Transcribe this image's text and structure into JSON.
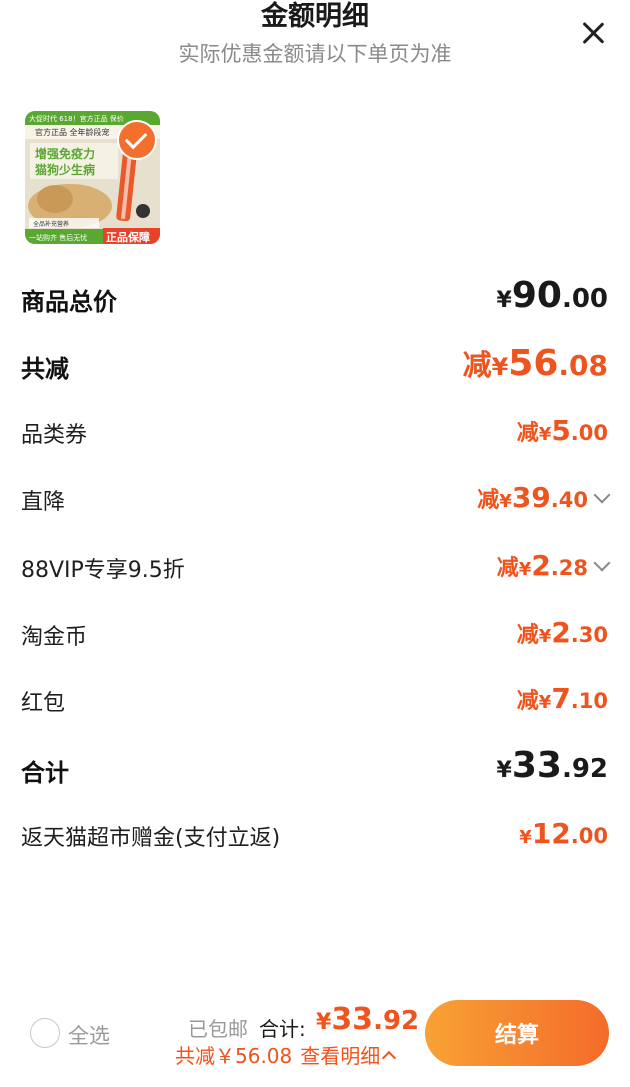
{
  "header": {
    "title": "金额明细",
    "subtitle": "实际优惠金额请以下单页为准"
  },
  "product": {
    "image_text": {
      "top_banner": "大促时代 618！官方正品 保价",
      "line1": "官方正品 全年龄段宠",
      "headline1": "增强免疫力",
      "headline2": "猫狗少生病",
      "footer_left": "一站购齐 售后无忧",
      "footer_right": "正品保障",
      "small": "全品补充营养"
    },
    "selected": true
  },
  "rows": {
    "total_price": {
      "label": "商品总价",
      "currency": "¥",
      "int": "90",
      "dec": ".00"
    },
    "total_discount": {
      "label": "共减",
      "prefix": "减",
      "currency": "¥",
      "int": "56",
      "dec": ".08"
    },
    "category_coupon": {
      "label": "品类券",
      "prefix": "减",
      "currency": "¥",
      "int": "5",
      "dec": ".00"
    },
    "direct_drop": {
      "label": "直降",
      "prefix": "减",
      "currency": "¥",
      "int": "39",
      "dec": ".40"
    },
    "vip": {
      "label": "88VIP专享9.5折",
      "prefix": "减",
      "currency": "¥",
      "int": "2",
      "dec": ".28"
    },
    "coins": {
      "label": "淘金币",
      "prefix": "减",
      "currency": "¥",
      "int": "2",
      "dec": ".30"
    },
    "redpacket": {
      "label": "红包",
      "prefix": "减",
      "currency": "¥",
      "int": "7",
      "dec": ".10"
    },
    "subtotal": {
      "label": "合计",
      "currency": "¥",
      "int": "33",
      "dec": ".92"
    },
    "cashback": {
      "label": "返天猫超市赠金(支付立返)",
      "currency": "¥",
      "int": "12",
      "dec": ".00"
    }
  },
  "footer": {
    "select_all": "全选",
    "shipping": "已包邮",
    "total_label": "合计:",
    "total_currency": "¥",
    "total_int": "33",
    "total_dec": ".92",
    "savings": "共减￥56.08",
    "view_detail": "查看明细",
    "checkout": "结算"
  },
  "colors": {
    "accent": "#f0541e",
    "button_start": "#f8a235",
    "button_end": "#f46b2a"
  }
}
